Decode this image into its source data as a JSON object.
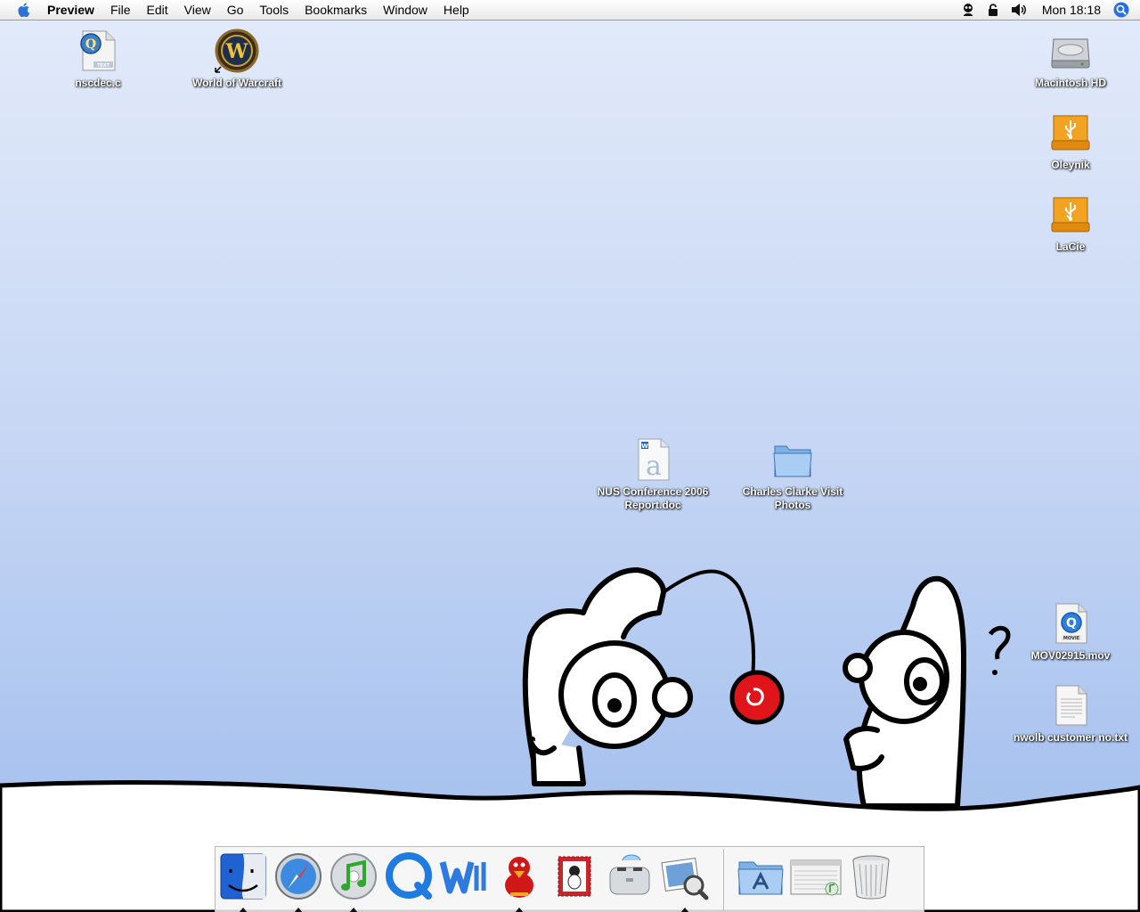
{
  "menubar": {
    "app_name": "Preview",
    "menus": [
      "File",
      "Edit",
      "View",
      "Go",
      "Tools",
      "Bookmarks",
      "Window",
      "Help"
    ],
    "clock": "Mon 18:18",
    "status_icons": [
      "user-icon",
      "lock-icon",
      "volume-icon",
      "spotlight-icon"
    ]
  },
  "desktop_icons": {
    "nscdec": {
      "label": "nscdec.c",
      "icon": "text-file-icon"
    },
    "wow": {
      "label": "World of Warcraft",
      "icon": "warcraft-alias-icon"
    },
    "macintosh_hd": {
      "label": "Macintosh HD",
      "icon": "hard-drive-icon"
    },
    "oleynik": {
      "label": "Oleynik",
      "icon": "usb-drive-icon"
    },
    "lacie": {
      "label": "LaCie",
      "icon": "usb-drive-icon"
    },
    "nus_report": {
      "label": "NUS Conference 2006 Report.doc",
      "icon": "word-document-icon"
    },
    "charles_clarke": {
      "label": "Charles Clarke Visit Photos",
      "icon": "folder-icon"
    },
    "mov": {
      "label": "MOV02915.mov",
      "icon": "movie-file-icon"
    },
    "nwolb": {
      "label": "nwolb customer no.txt",
      "icon": "text-file-icon"
    }
  },
  "dock": {
    "apps": [
      {
        "name": "Finder",
        "icon": "finder-icon",
        "running": true
      },
      {
        "name": "Safari",
        "icon": "safari-icon",
        "running": true
      },
      {
        "name": "iTunes",
        "icon": "itunes-icon",
        "running": true
      },
      {
        "name": "QuickTime Player",
        "icon": "quicktime-icon",
        "running": false
      },
      {
        "name": "Microsoft Word",
        "icon": "word-icon",
        "running": false
      },
      {
        "name": "Adium",
        "icon": "adium-duck-icon",
        "running": true
      },
      {
        "name": "Mail Stamp",
        "icon": "stamp-icon",
        "running": false
      },
      {
        "name": "Toast",
        "icon": "toaster-icon",
        "running": false
      },
      {
        "name": "Preview",
        "icon": "preview-icon",
        "running": true
      }
    ],
    "others": [
      {
        "name": "Applications",
        "icon": "applications-folder-icon"
      },
      {
        "name": "Music Window",
        "icon": "window-icon"
      },
      {
        "name": "Trash",
        "icon": "trash-icon"
      }
    ]
  },
  "colors": {
    "desktop_top": "#e3ebfa",
    "desktop_bottom": "#a9c3ef",
    "label_text": "#ffffff",
    "yoyo_red": "#e0141b"
  }
}
